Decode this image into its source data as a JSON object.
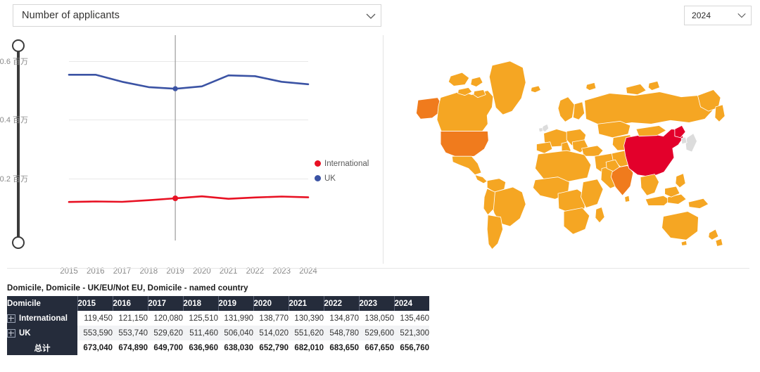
{
  "controls": {
    "metric_dropdown": {
      "value": "Number of applicants",
      "icon": "chevron-down-icon"
    },
    "year_dropdown": {
      "value": "2024",
      "icon": "chevron-down-icon"
    }
  },
  "chart_data": {
    "type": "line",
    "title": "",
    "xlabel": "",
    "ylabel": "",
    "categories": [
      "2015",
      "2016",
      "2017",
      "2018",
      "2019",
      "2020",
      "2021",
      "2022",
      "2023",
      "2024"
    ],
    "ytick_labels": [
      "0.6 百万",
      "0.4 百万",
      "0.2 百万"
    ],
    "ytick_values": [
      600000,
      400000,
      200000
    ],
    "ylim": [
      0,
      660000
    ],
    "grid": true,
    "legend_position": "right",
    "crosshair_year": "2019",
    "series": [
      {
        "name": "International",
        "color": "#E81123",
        "values": [
          119450,
          121150,
          120080,
          125510,
          131990,
          138770,
          130390,
          134870,
          138050,
          135460
        ]
      },
      {
        "name": "UK",
        "color": "#3B53A4",
        "values": [
          553590,
          553740,
          529620,
          511460,
          506040,
          514020,
          551620,
          548780,
          529600,
          521300
        ]
      }
    ]
  },
  "slider": {
    "name": "vertical-range-slider",
    "top_handle": "max",
    "bottom_handle": "min"
  },
  "map": {
    "name": "world-choropleth-map",
    "colors": {
      "default": "#F5A623",
      "mid": "#F07B1D",
      "high": "#E3002B",
      "none": "#DCDCDC"
    },
    "highlight_high": "China",
    "highlight_mid": [
      "India",
      "United States"
    ]
  },
  "table": {
    "title": "Domicile, Domicile - UK/EU/Not EU, Domicile - named country",
    "columns": [
      "Domicile",
      "2015",
      "2016",
      "2017",
      "2018",
      "2019",
      "2020",
      "2021",
      "2022",
      "2023",
      "2024"
    ],
    "rows": [
      {
        "label": "International",
        "expandable": true,
        "values": [
          "119,450",
          "121,150",
          "120,080",
          "125,510",
          "131,990",
          "138,770",
          "130,390",
          "134,870",
          "138,050",
          "135,460"
        ]
      },
      {
        "label": "UK",
        "expandable": true,
        "values": [
          "553,590",
          "553,740",
          "529,620",
          "511,460",
          "506,040",
          "514,020",
          "551,620",
          "548,780",
          "529,600",
          "521,300"
        ]
      }
    ],
    "total_row": {
      "label": "总计",
      "values": [
        "673,040",
        "674,890",
        "649,700",
        "636,960",
        "638,030",
        "652,790",
        "682,010",
        "683,650",
        "667,650",
        "656,760"
      ]
    }
  }
}
